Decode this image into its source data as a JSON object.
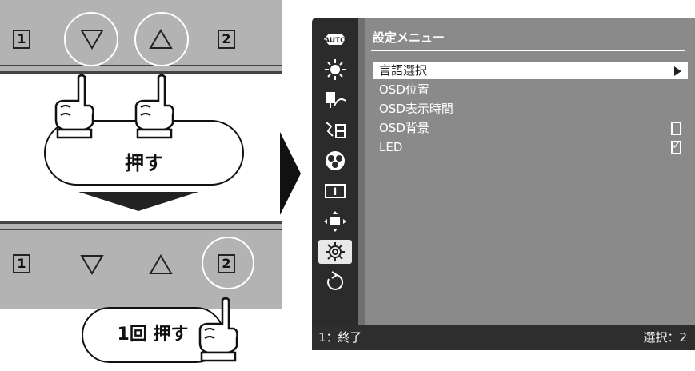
{
  "left_panel": {
    "keys": [
      "1",
      "2"
    ],
    "press_label": "押す",
    "press_once_label": "1回 押す"
  },
  "osd": {
    "title": "設定メニュー",
    "sidebar": [
      "auto-icon",
      "brightness-icon",
      "input-signal-icon",
      "audio-icon",
      "color-rgb-icon",
      "info-icon",
      "position-icon",
      "settings-gear-icon",
      "reset-icon"
    ],
    "active_sidebar_index": 7,
    "menu_items": [
      {
        "label": "言語選択",
        "selected": true,
        "control": "arrow"
      },
      {
        "label": "OSD位置",
        "selected": false,
        "control": "none"
      },
      {
        "label": "OSD表示時間",
        "selected": false,
        "control": "none"
      },
      {
        "label": "OSD背景",
        "selected": false,
        "control": "checkbox",
        "checked": false
      },
      {
        "label": "LED",
        "selected": false,
        "control": "checkbox",
        "checked": true
      }
    ],
    "footer_left": "1：終了",
    "footer_right": "選択：2"
  }
}
